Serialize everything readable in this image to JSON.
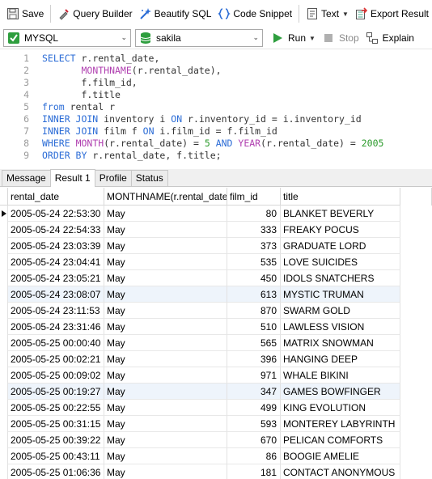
{
  "toolbar": {
    "save": "Save",
    "query_builder": "Query Builder",
    "beautify_sql": "Beautify SQL",
    "code_snippet": "Code Snippet",
    "text": "Text",
    "export_result": "Export Result"
  },
  "connection": {
    "server": "MYSQL",
    "database": "sakila",
    "run": "Run",
    "stop": "Stop",
    "explain": "Explain"
  },
  "editor": {
    "line_numbers": [
      "1",
      "2",
      "3",
      "4",
      "5",
      "6",
      "7",
      "8",
      "9"
    ]
  },
  "tabs": [
    "Message",
    "Result 1",
    "Profile",
    "Status"
  ],
  "active_tab": "Result 1",
  "grid": {
    "columns": [
      "rental_date",
      "MONTHNAME(r.rental_date",
      "film_id",
      "title"
    ],
    "rows": [
      [
        "2005-05-24 22:53:30",
        "May",
        "80",
        "BLANKET BEVERLY"
      ],
      [
        "2005-05-24 22:54:33",
        "May",
        "333",
        "FREAKY POCUS"
      ],
      [
        "2005-05-24 23:03:39",
        "May",
        "373",
        "GRADUATE LORD"
      ],
      [
        "2005-05-24 23:04:41",
        "May",
        "535",
        "LOVE SUICIDES"
      ],
      [
        "2005-05-24 23:05:21",
        "May",
        "450",
        "IDOLS SNATCHERS"
      ],
      [
        "2005-05-24 23:08:07",
        "May",
        "613",
        "MYSTIC TRUMAN"
      ],
      [
        "2005-05-24 23:11:53",
        "May",
        "870",
        "SWARM GOLD"
      ],
      [
        "2005-05-24 23:31:46",
        "May",
        "510",
        "LAWLESS VISION"
      ],
      [
        "2005-05-25 00:00:40",
        "May",
        "565",
        "MATRIX SNOWMAN"
      ],
      [
        "2005-05-25 00:02:21",
        "May",
        "396",
        "HANGING DEEP"
      ],
      [
        "2005-05-25 00:09:02",
        "May",
        "971",
        "WHALE BIKINI"
      ],
      [
        "2005-05-25 00:19:27",
        "May",
        "347",
        "GAMES BOWFINGER"
      ],
      [
        "2005-05-25 00:22:55",
        "May",
        "499",
        "KING EVOLUTION"
      ],
      [
        "2005-05-25 00:31:15",
        "May",
        "593",
        "MONTEREY LABYRINTH"
      ],
      [
        "2005-05-25 00:39:22",
        "May",
        "670",
        "PELICAN COMFORTS"
      ],
      [
        "2005-05-25 00:43:11",
        "May",
        "86",
        "BOOGIE AMELIE"
      ],
      [
        "2005-05-25 01:06:36",
        "May",
        "181",
        "CONTACT ANONYMOUS"
      ]
    ]
  },
  "colors": {
    "keyword": "#2b6cd6",
    "function": "#b040b0",
    "number": "#2a9a2a",
    "run_green": "#2e9e3e",
    "stripe": "#f7fafd"
  },
  "icons": [
    "save-icon",
    "query-builder-icon",
    "beautify-icon",
    "code-snippet-icon",
    "text-icon",
    "export-icon",
    "mysql-connection-icon",
    "database-icon",
    "run-icon",
    "stop-icon",
    "explain-icon"
  ]
}
